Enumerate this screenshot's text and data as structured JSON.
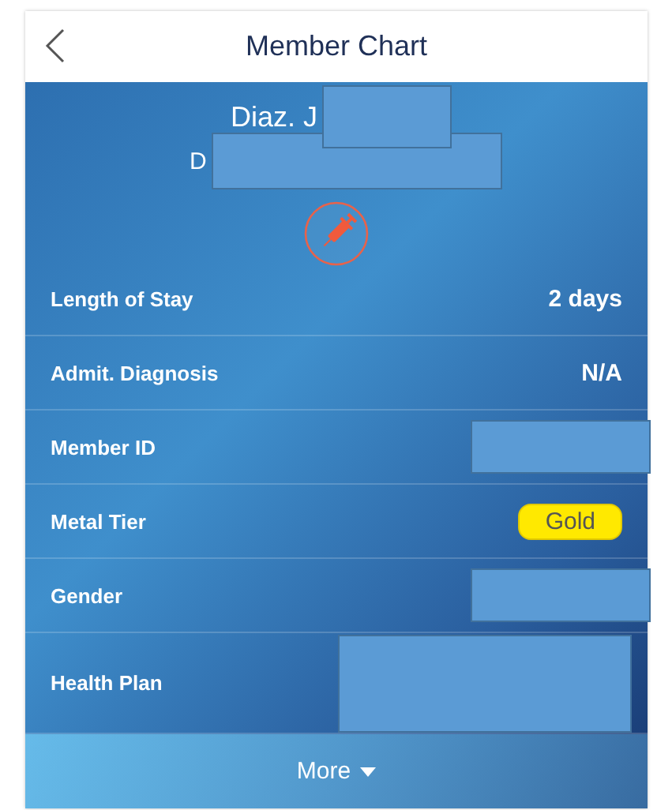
{
  "header": {
    "title": "Member Chart"
  },
  "member": {
    "name": "Diaz. J",
    "name_redacted": true,
    "subtitle": "D",
    "subtitle_redacted": true
  },
  "rows": [
    {
      "label": "Length of Stay",
      "kind": "text",
      "value": "2 days"
    },
    {
      "label": "Admit. Diagnosis",
      "kind": "text",
      "value": "N/A"
    },
    {
      "label": "Member ID",
      "kind": "redacted"
    },
    {
      "label": "Metal Tier",
      "kind": "badge",
      "value": "Gold"
    },
    {
      "label": "Gender",
      "kind": "redacted"
    },
    {
      "label": "Health Plan",
      "kind": "redacted-tall"
    }
  ],
  "more_button": {
    "label": "More"
  }
}
